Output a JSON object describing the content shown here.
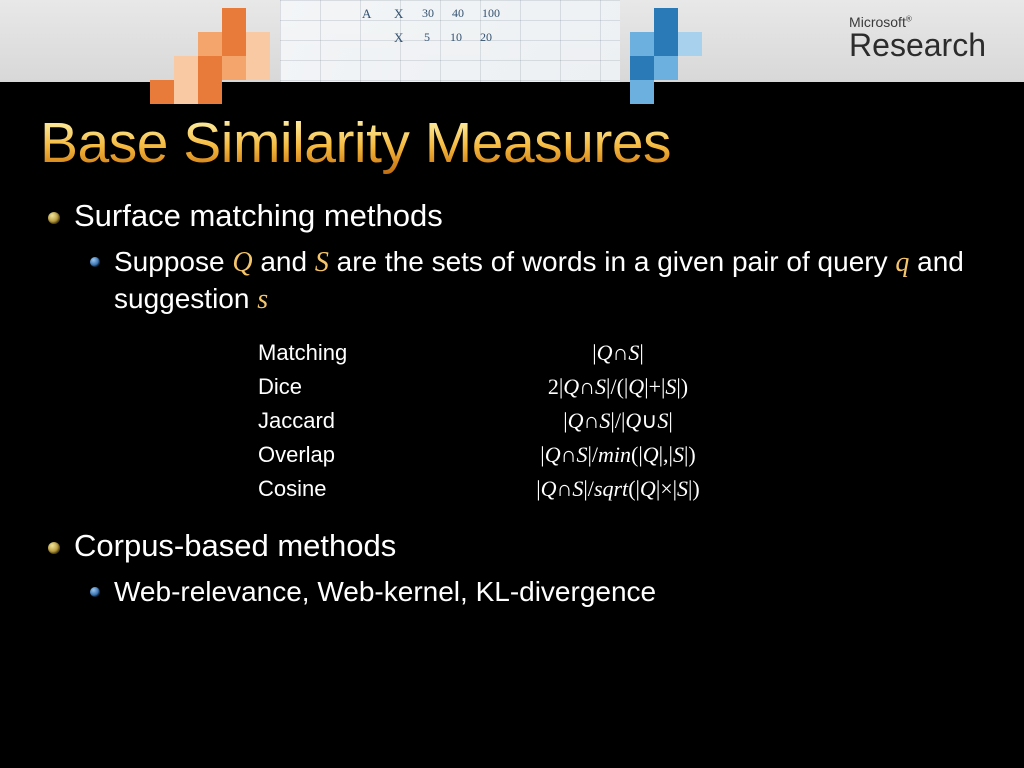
{
  "header": {
    "logo_top": "Microsoft",
    "logo_bottom": "Research"
  },
  "title": "Base Similarity Measures",
  "sections": [
    {
      "heading": "Surface matching methods",
      "sub_prefix": "Suppose ",
      "sub_Q": "Q",
      "sub_mid1": " and ",
      "sub_S": "S",
      "sub_mid2": " are the sets of words in a given pair of query ",
      "sub_q": "q",
      "sub_mid3": " and suggestion ",
      "sub_s": "s"
    },
    {
      "heading": "Corpus-based methods",
      "sub_text": "Web-relevance, Web-kernel, KL-divergence"
    }
  ],
  "formulas": [
    {
      "name": "Matching",
      "formula": "|Q∩S|"
    },
    {
      "name": "Dice",
      "formula": "2|Q∩S|/(|Q|+|S|)"
    },
    {
      "name": "Jaccard",
      "formula": "|Q∩S|/|Q∪S|"
    },
    {
      "name": "Overlap",
      "formula": "|Q∩S|/min(|Q|,|S|)"
    },
    {
      "name": "Cosine",
      "formula": "|Q∩S|/sqrt(|Q|×|S|)"
    }
  ]
}
